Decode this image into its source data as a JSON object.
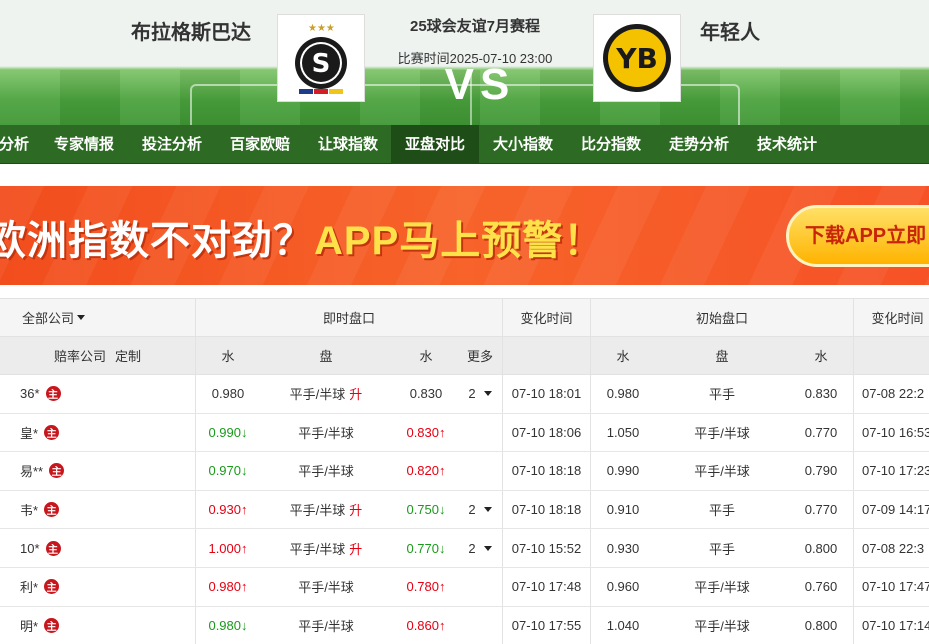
{
  "match": {
    "home_team": "布拉格斯巴达",
    "away_team": "年轻人",
    "title": "25球会友谊7月赛程",
    "time": "比赛时间2025-07-10 23:00",
    "vs": "VS"
  },
  "nav": {
    "items": [
      {
        "label": "分析",
        "active": false
      },
      {
        "label": "专家情报",
        "active": false
      },
      {
        "label": "投注分析",
        "active": false
      },
      {
        "label": "百家欧赔",
        "active": false
      },
      {
        "label": "让球指数",
        "active": false
      },
      {
        "label": "亚盘对比",
        "active": true
      },
      {
        "label": "大小指数",
        "active": false
      },
      {
        "label": "比分指数",
        "active": false
      },
      {
        "label": "走势分析",
        "active": false
      },
      {
        "label": "技术统计",
        "active": false
      }
    ]
  },
  "banner": {
    "text_a": "欧洲指数不对劲？",
    "text_b": "APP马上预警！",
    "button": "下载APP立即"
  },
  "table": {
    "header1": {
      "all_company": "全部公司",
      "live": "即时盘口",
      "change_time": "变化时间",
      "initial": "初始盘口",
      "change_time2": "变化时间"
    },
    "header2": {
      "company": "赔率公司",
      "custom": "定制",
      "water1": "水",
      "handicap": "盘",
      "water2": "水",
      "more": "更多",
      "water3": "水",
      "handicap2": "盘",
      "water4": "水"
    },
    "badge": "主",
    "rows": [
      {
        "company": "36*",
        "lw1": "0.980",
        "lw1_dir": "",
        "lh": "平手/半球",
        "lh_up": "升",
        "lw2": "0.830",
        "lw2_dir": "",
        "more": "2",
        "time": "07-10 18:01",
        "iw1": "0.980",
        "ih": "平手",
        "iw2": "0.830",
        "itime": "07-08 22:2"
      },
      {
        "company": "皇*",
        "lw1": "0.990",
        "lw1_dir": "down",
        "lh": "平手/半球",
        "lh_up": "",
        "lw2": "0.830",
        "lw2_dir": "up",
        "more": "",
        "time": "07-10 18:06",
        "iw1": "1.050",
        "ih": "平手/半球",
        "iw2": "0.770",
        "itime": "07-10 16:53"
      },
      {
        "company": "易**",
        "lw1": "0.970",
        "lw1_dir": "down",
        "lh": "平手/半球",
        "lh_up": "",
        "lw2": "0.820",
        "lw2_dir": "up",
        "more": "",
        "time": "07-10 18:18",
        "iw1": "0.990",
        "ih": "平手/半球",
        "iw2": "0.790",
        "itime": "07-10 17:23"
      },
      {
        "company": "韦*",
        "lw1": "0.930",
        "lw1_dir": "up",
        "lh": "平手/半球",
        "lh_up": "升",
        "lw2": "0.750",
        "lw2_dir": "down",
        "more": "2",
        "time": "07-10 18:18",
        "iw1": "0.910",
        "ih": "平手",
        "iw2": "0.770",
        "itime": "07-09 14:17"
      },
      {
        "company": "10*",
        "lw1": "1.000",
        "lw1_dir": "up",
        "lh": "平手/半球",
        "lh_up": "升",
        "lw2": "0.770",
        "lw2_dir": "down",
        "more": "2",
        "time": "07-10 15:52",
        "iw1": "0.930",
        "ih": "平手",
        "iw2": "0.800",
        "itime": "07-08 22:3"
      },
      {
        "company": "利*",
        "lw1": "0.980",
        "lw1_dir": "up",
        "lh": "平手/半球",
        "lh_up": "",
        "lw2": "0.780",
        "lw2_dir": "up",
        "more": "",
        "time": "07-10 17:48",
        "iw1": "0.960",
        "ih": "平手/半球",
        "iw2": "0.760",
        "itime": "07-10 17:47"
      },
      {
        "company": "明*",
        "lw1": "0.980",
        "lw1_dir": "down",
        "lh": "平手/半球",
        "lh_up": "",
        "lw2": "0.860",
        "lw2_dir": "up",
        "more": "",
        "time": "07-10 17:55",
        "iw1": "1.040",
        "ih": "平手/半球",
        "iw2": "0.800",
        "itime": "07-10 17:14"
      }
    ]
  },
  "colors": {
    "nav_bg": "#2d6b24",
    "up": "#e60012",
    "down": "#1a9a1a",
    "banner": "#f24d1d"
  }
}
